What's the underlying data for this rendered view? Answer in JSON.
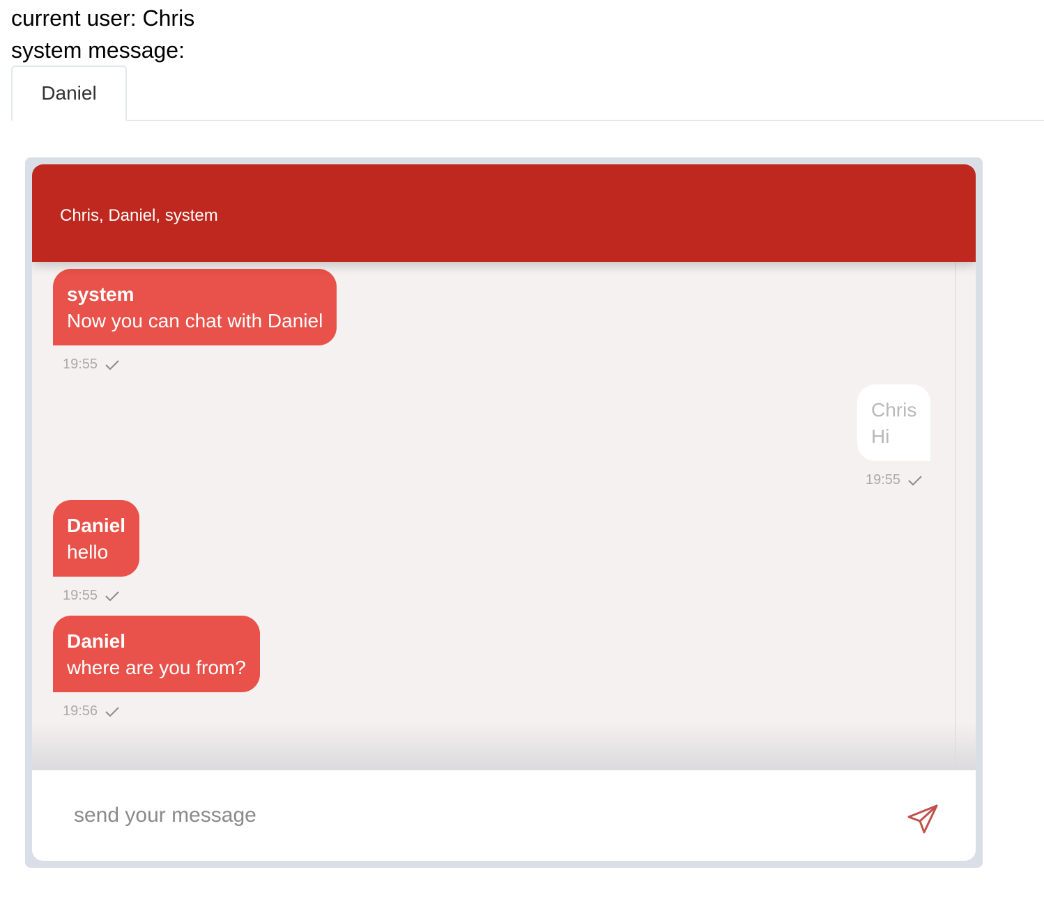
{
  "current_user": "current user: Chris",
  "system_message": "system message:",
  "tabs": [
    {
      "label": "Daniel"
    }
  ],
  "chat": {
    "participants": "Chris, Daniel, system",
    "messages": [
      {
        "sender": "system",
        "text": "Now you can chat with Daniel",
        "time": "19:55",
        "direction": "incoming"
      },
      {
        "sender": "Chris",
        "text": "Hi",
        "time": "19:55",
        "direction": "outgoing"
      },
      {
        "sender": "Daniel",
        "text": "hello",
        "time": "19:55",
        "direction": "incoming"
      },
      {
        "sender": "Daniel",
        "text": "where are you from?",
        "time": "19:56",
        "direction": "incoming"
      }
    ],
    "input_placeholder": "send your message",
    "send_icon": "send-icon",
    "check_icon": "check-icon"
  },
  "colors": {
    "header": "#bf281e",
    "incoming_bubble": "#e8524a",
    "outgoing_bubble": "#ffffff",
    "chat_background": "#f5f1f1",
    "frame": "#d9dee7"
  }
}
